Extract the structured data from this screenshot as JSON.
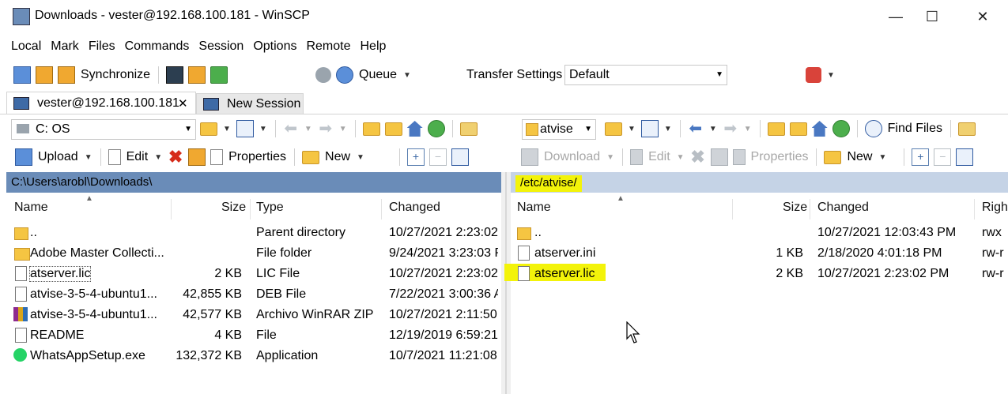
{
  "window": {
    "title": "Downloads - vester@192.168.100.181 - WinSCP",
    "minimize": "—",
    "maximize": "☐",
    "close": "✕"
  },
  "menu": [
    "Local",
    "Mark",
    "Files",
    "Commands",
    "Session",
    "Options",
    "Remote",
    "Help"
  ],
  "toolbar": {
    "synchronize_label": "Synchronize",
    "queue_label": "Queue",
    "transfer_settings_label": "Transfer Settings",
    "transfer_settings_value": "Default"
  },
  "tabs": {
    "active_session": "vester@192.168.100.181",
    "active_close": "✕",
    "new_session": "New Session"
  },
  "left": {
    "drive": "C: OS",
    "upload_label": "Upload",
    "edit_label": "Edit",
    "properties_label": "Properties",
    "new_label": "New",
    "path": "C:\\Users\\arobl\\Downloads\\",
    "columns": [
      "Name",
      "Size",
      "Type",
      "Changed"
    ],
    "rows": [
      {
        "icon": "parent-dir-icon",
        "name": "..",
        "size": "",
        "type": "Parent directory",
        "changed": "10/27/2021  2:23:02"
      },
      {
        "icon": "folder-icon",
        "name": "Adobe Master Collecti...",
        "size": "",
        "type": "File folder",
        "changed": "9/24/2021  3:23:03 P"
      },
      {
        "icon": "file-icon",
        "name": "atserver.lic",
        "size": "2 KB",
        "type": "LIC File",
        "changed": "10/27/2021  2:23:02"
      },
      {
        "icon": "file-icon",
        "name": "atvise-3-5-4-ubuntu1...",
        "size": "42,855 KB",
        "type": "DEB File",
        "changed": "7/22/2021  3:00:36 A"
      },
      {
        "icon": "winrar-icon",
        "name": "atvise-3-5-4-ubuntu1...",
        "size": "42,577 KB",
        "type": "Archivo WinRAR ZIP",
        "changed": "10/27/2021  2:11:50"
      },
      {
        "icon": "file-icon",
        "name": "README",
        "size": "4 KB",
        "type": "File",
        "changed": "12/19/2019  6:59:21"
      },
      {
        "icon": "whatsapp-icon",
        "name": "WhatsAppSetup.exe",
        "size": "132,372 KB",
        "type": "Application",
        "changed": "10/7/2021  11:21:08"
      }
    ]
  },
  "right": {
    "folder": "atvise",
    "find_files_label": "Find Files",
    "download_label": "Download",
    "edit_label": "Edit",
    "properties_label": "Properties",
    "new_label": "New",
    "path": "/etc/atvise/",
    "columns": [
      "Name",
      "Size",
      "Changed",
      "Righ"
    ],
    "rows": [
      {
        "icon": "parent-dir-icon",
        "name": "..",
        "size": "",
        "changed": "10/27/2021 12:03:43 PM",
        "rights": "rwx"
      },
      {
        "icon": "settings-file-icon",
        "name": "atserver.ini",
        "size": "1 KB",
        "changed": "2/18/2020 4:01:18 PM",
        "rights": "rw-r"
      },
      {
        "icon": "file-icon",
        "name": "atserver.lic",
        "size": "2 KB",
        "changed": "10/27/2021 2:23:02 PM",
        "rights": "rw-r"
      }
    ]
  },
  "colors": {
    "left_path_bg": "#6a8cb8",
    "right_path_bg": "#c5d3e6",
    "highlight": "#f3f30a"
  }
}
